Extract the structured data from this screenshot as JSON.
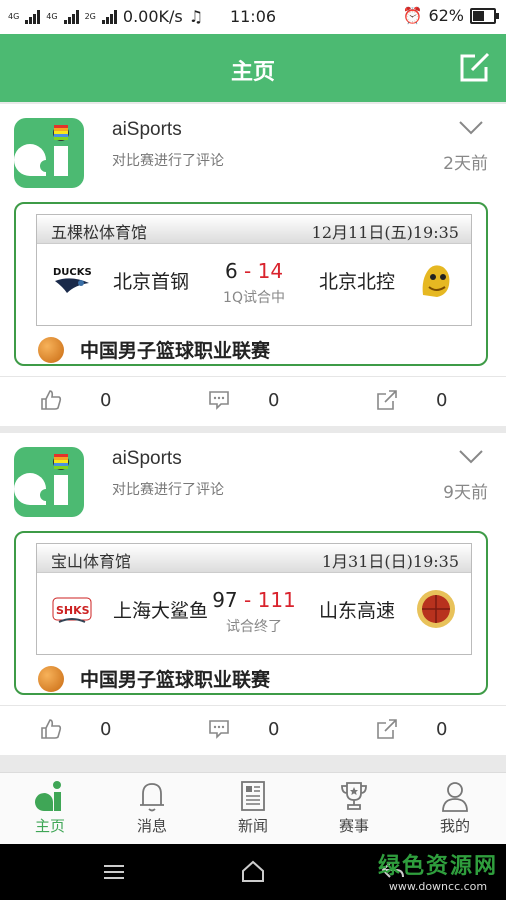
{
  "status_bar": {
    "network_tags": [
      "4G",
      "4G",
      "2G"
    ],
    "speed": "0.00K/s",
    "time": "11:06",
    "battery": "62%",
    "battery_level": 0.62
  },
  "header": {
    "title": "主页"
  },
  "feed": [
    {
      "user": "aiSports",
      "action": "对比赛进行了评论",
      "time": "2天前",
      "venue": "五棵松体育馆",
      "date": "12月11日(五)19:35",
      "home_team": "北京首钢",
      "away_team": "北京北控",
      "home_score": "6",
      "away_score": "14",
      "separator": "-",
      "status": "1Q试合中",
      "league": "中国男子篮球职业联赛",
      "likes": "0",
      "comments": "0",
      "shares": "0"
    },
    {
      "user": "aiSports",
      "action": "对比赛进行了评论",
      "time": "9天前",
      "venue": "宝山体育馆",
      "date": "1月31日(日)19:35",
      "home_team": "上海大鲨鱼",
      "away_team": "山东高速",
      "home_score": "97",
      "away_score": "111",
      "separator": "-",
      "status": "试合终了",
      "league": "中国男子篮球职业联赛",
      "likes": "0",
      "comments": "0",
      "shares": "0"
    }
  ],
  "tabs": [
    {
      "label": "主页",
      "icon": "home-ai-icon",
      "active": true
    },
    {
      "label": "消息",
      "icon": "bell-icon",
      "active": false
    },
    {
      "label": "新闻",
      "icon": "newspaper-icon",
      "active": false
    },
    {
      "label": "赛事",
      "icon": "trophy-icon",
      "active": false
    },
    {
      "label": "我的",
      "icon": "person-icon",
      "active": false
    }
  ],
  "watermark": {
    "title": "绿色资源网",
    "url": "www.downcc.com"
  },
  "colors": {
    "brand_green": "#4cba72",
    "score_red": "#d9232d",
    "border_green": "#3e9b47"
  }
}
